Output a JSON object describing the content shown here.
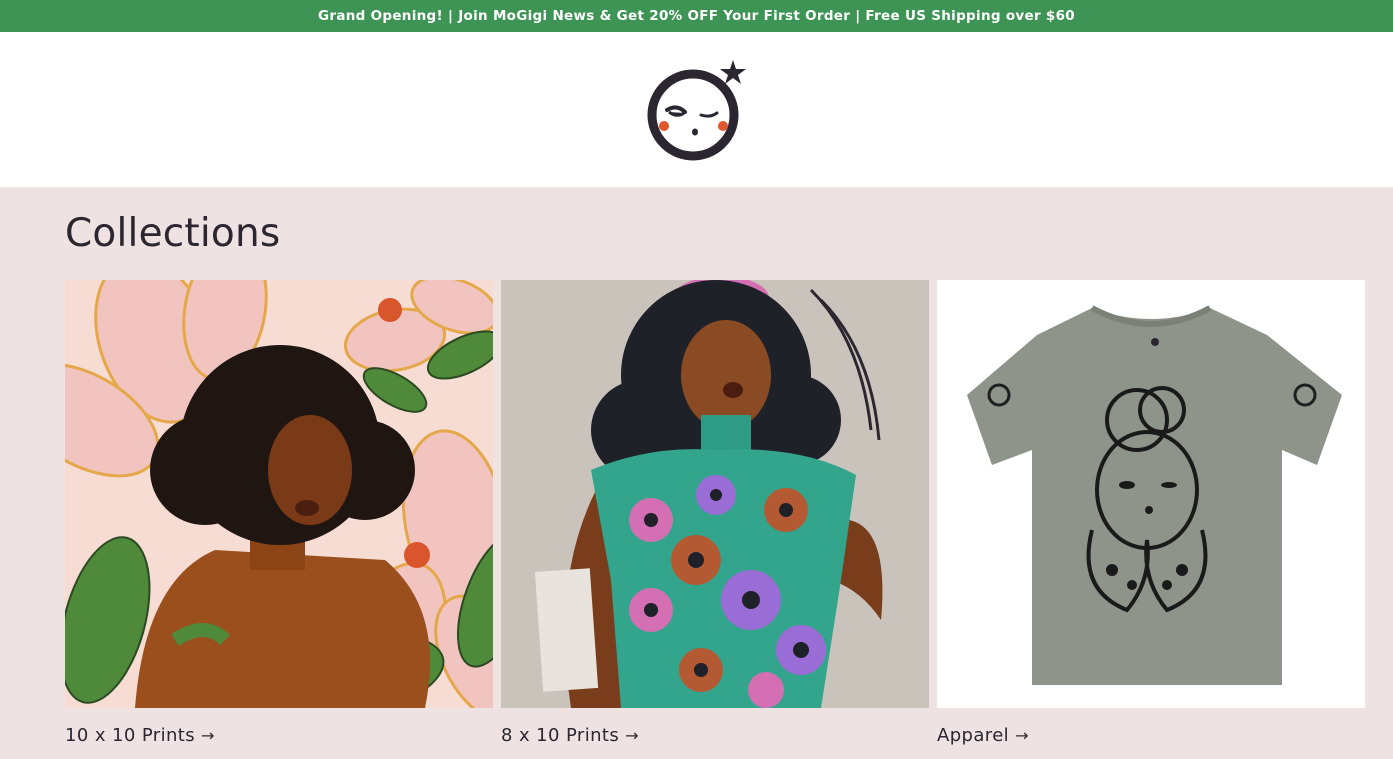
{
  "announcement": {
    "text": "Grand Opening! | Join MoGigi News & Get 20% OFF Your First Order | Free US Shipping over $60"
  },
  "header": {
    "logo_icon": "mogigi-face-star-logo-icon"
  },
  "collections": {
    "title": "Collections",
    "items": [
      {
        "label": "10 x 10 Prints",
        "image": "woman-with-flowers-illustration"
      },
      {
        "label": "8 x 10 Prints",
        "image": "woman-floral-dress-illustration"
      },
      {
        "label": "Apparel",
        "image": "grey-illustrated-tshirt"
      }
    ],
    "arrow_glyph": "→"
  },
  "colors": {
    "announcement_bg": "#3e9455",
    "page_bg": "#efe2e2",
    "header_bg": "#ffffff",
    "text": "#2b2630"
  }
}
